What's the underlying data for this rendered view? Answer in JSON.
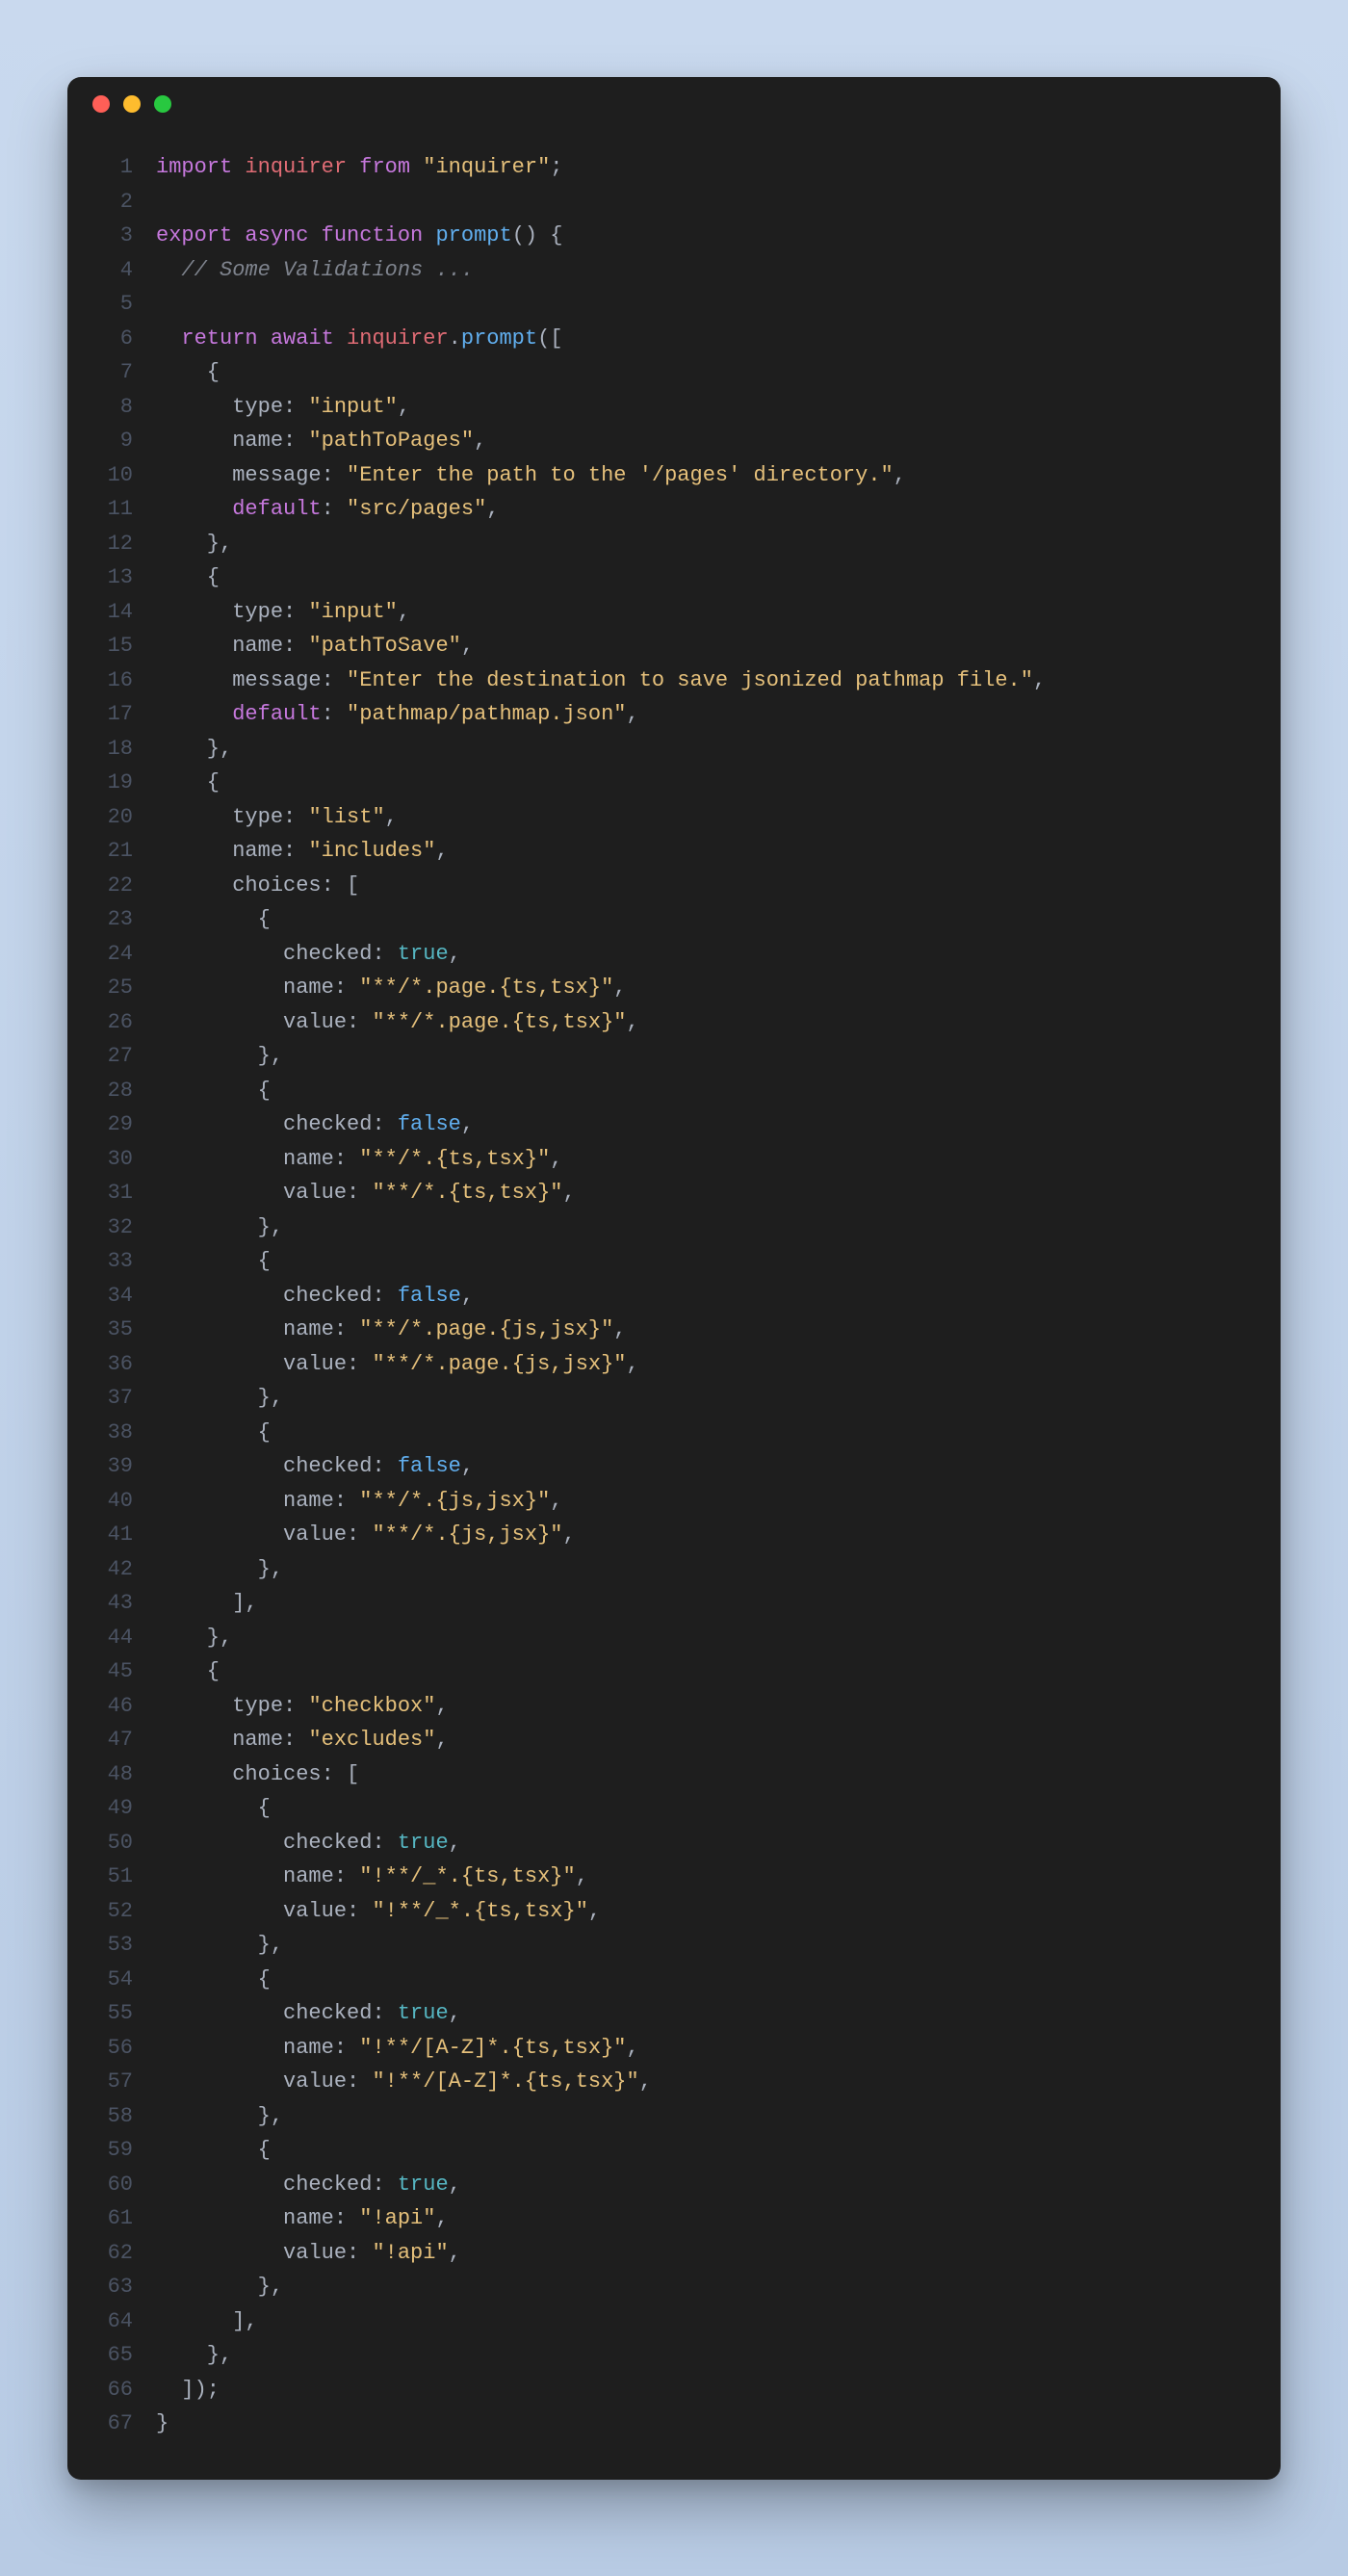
{
  "window": {
    "dots": [
      "red",
      "yellow",
      "green"
    ]
  },
  "lines": [
    {
      "n": 1,
      "tokens": [
        [
          "tk-key",
          "import "
        ],
        [
          "tk-var",
          "inquirer "
        ],
        [
          "tk-key",
          "from "
        ],
        [
          "tk-str2",
          "\"inquirer\""
        ],
        [
          "tk-punc",
          ";"
        ]
      ]
    },
    {
      "n": 2,
      "tokens": []
    },
    {
      "n": 3,
      "tokens": [
        [
          "tk-key",
          "export "
        ],
        [
          "tk-key",
          "async "
        ],
        [
          "tk-key",
          "function "
        ],
        [
          "tk-func",
          "prompt"
        ],
        [
          "tk-punc",
          "() {"
        ]
      ]
    },
    {
      "n": 4,
      "tokens": [
        [
          "tk-punc",
          "  "
        ],
        [
          "tk-comm",
          "// Some Validations ..."
        ]
      ]
    },
    {
      "n": 5,
      "tokens": []
    },
    {
      "n": 6,
      "tokens": [
        [
          "tk-punc",
          "  "
        ],
        [
          "tk-key",
          "return "
        ],
        [
          "tk-key",
          "await "
        ],
        [
          "tk-var",
          "inquirer"
        ],
        [
          "tk-punc",
          "."
        ],
        [
          "tk-func",
          "prompt"
        ],
        [
          "tk-punc",
          "(["
        ]
      ]
    },
    {
      "n": 7,
      "tokens": [
        [
          "tk-punc",
          "    {"
        ]
      ]
    },
    {
      "n": 8,
      "tokens": [
        [
          "tk-punc",
          "      "
        ],
        [
          "tk-prop",
          "type"
        ],
        [
          "tk-punc",
          ": "
        ],
        [
          "tk-str2",
          "\"input\""
        ],
        [
          "tk-punc",
          ","
        ]
      ]
    },
    {
      "n": 9,
      "tokens": [
        [
          "tk-punc",
          "      "
        ],
        [
          "tk-prop",
          "name"
        ],
        [
          "tk-punc",
          ": "
        ],
        [
          "tk-str2",
          "\"pathToPages\""
        ],
        [
          "tk-punc",
          ","
        ]
      ]
    },
    {
      "n": 10,
      "tokens": [
        [
          "tk-punc",
          "      "
        ],
        [
          "tk-prop",
          "message"
        ],
        [
          "tk-punc",
          ": "
        ],
        [
          "tk-str2",
          "\"Enter the path to the '/pages' directory.\""
        ],
        [
          "tk-punc",
          ","
        ]
      ]
    },
    {
      "n": 11,
      "tokens": [
        [
          "tk-punc",
          "      "
        ],
        [
          "tk-key",
          "default"
        ],
        [
          "tk-punc",
          ": "
        ],
        [
          "tk-str2",
          "\"src/pages\""
        ],
        [
          "tk-punc",
          ","
        ]
      ]
    },
    {
      "n": 12,
      "tokens": [
        [
          "tk-punc",
          "    },"
        ]
      ]
    },
    {
      "n": 13,
      "tokens": [
        [
          "tk-punc",
          "    {"
        ]
      ]
    },
    {
      "n": 14,
      "tokens": [
        [
          "tk-punc",
          "      "
        ],
        [
          "tk-prop",
          "type"
        ],
        [
          "tk-punc",
          ": "
        ],
        [
          "tk-str2",
          "\"input\""
        ],
        [
          "tk-punc",
          ","
        ]
      ]
    },
    {
      "n": 15,
      "tokens": [
        [
          "tk-punc",
          "      "
        ],
        [
          "tk-prop",
          "name"
        ],
        [
          "tk-punc",
          ": "
        ],
        [
          "tk-str2",
          "\"pathToSave\""
        ],
        [
          "tk-punc",
          ","
        ]
      ]
    },
    {
      "n": 16,
      "tokens": [
        [
          "tk-punc",
          "      "
        ],
        [
          "tk-prop",
          "message"
        ],
        [
          "tk-punc",
          ": "
        ],
        [
          "tk-str2",
          "\"Enter the destination to save jsonized pathmap file.\""
        ],
        [
          "tk-punc",
          ","
        ]
      ]
    },
    {
      "n": 17,
      "tokens": [
        [
          "tk-punc",
          "      "
        ],
        [
          "tk-key",
          "default"
        ],
        [
          "tk-punc",
          ": "
        ],
        [
          "tk-str2",
          "\"pathmap/pathmap.json\""
        ],
        [
          "tk-punc",
          ","
        ]
      ]
    },
    {
      "n": 18,
      "tokens": [
        [
          "tk-punc",
          "    },"
        ]
      ]
    },
    {
      "n": 19,
      "tokens": [
        [
          "tk-punc",
          "    {"
        ]
      ]
    },
    {
      "n": 20,
      "tokens": [
        [
          "tk-punc",
          "      "
        ],
        [
          "tk-prop",
          "type"
        ],
        [
          "tk-punc",
          ": "
        ],
        [
          "tk-str2",
          "\"list\""
        ],
        [
          "tk-punc",
          ","
        ]
      ]
    },
    {
      "n": 21,
      "tokens": [
        [
          "tk-punc",
          "      "
        ],
        [
          "tk-prop",
          "name"
        ],
        [
          "tk-punc",
          ": "
        ],
        [
          "tk-str2",
          "\"includes\""
        ],
        [
          "tk-punc",
          ","
        ]
      ]
    },
    {
      "n": 22,
      "tokens": [
        [
          "tk-punc",
          "      "
        ],
        [
          "tk-prop",
          "choices"
        ],
        [
          "tk-punc",
          ": ["
        ]
      ]
    },
    {
      "n": 23,
      "tokens": [
        [
          "tk-punc",
          "        {"
        ]
      ]
    },
    {
      "n": 24,
      "tokens": [
        [
          "tk-punc",
          "          "
        ],
        [
          "tk-prop",
          "checked"
        ],
        [
          "tk-punc",
          ": "
        ],
        [
          "tk-bool",
          "true"
        ],
        [
          "tk-punc",
          ","
        ]
      ]
    },
    {
      "n": 25,
      "tokens": [
        [
          "tk-punc",
          "          "
        ],
        [
          "tk-prop",
          "name"
        ],
        [
          "tk-punc",
          ": "
        ],
        [
          "tk-str2",
          "\"**/*.page.{ts,tsx}\""
        ],
        [
          "tk-punc",
          ","
        ]
      ]
    },
    {
      "n": 26,
      "tokens": [
        [
          "tk-punc",
          "          "
        ],
        [
          "tk-prop",
          "value"
        ],
        [
          "tk-punc",
          ": "
        ],
        [
          "tk-str2",
          "\"**/*.page.{ts,tsx}\""
        ],
        [
          "tk-punc",
          ","
        ]
      ]
    },
    {
      "n": 27,
      "tokens": [
        [
          "tk-punc",
          "        },"
        ]
      ]
    },
    {
      "n": 28,
      "tokens": [
        [
          "tk-punc",
          "        {"
        ]
      ]
    },
    {
      "n": 29,
      "tokens": [
        [
          "tk-punc",
          "          "
        ],
        [
          "tk-prop",
          "checked"
        ],
        [
          "tk-punc",
          ": "
        ],
        [
          "tk-boolF",
          "false"
        ],
        [
          "tk-punc",
          ","
        ]
      ]
    },
    {
      "n": 30,
      "tokens": [
        [
          "tk-punc",
          "          "
        ],
        [
          "tk-prop",
          "name"
        ],
        [
          "tk-punc",
          ": "
        ],
        [
          "tk-str2",
          "\"**/*.{ts,tsx}\""
        ],
        [
          "tk-punc",
          ","
        ]
      ]
    },
    {
      "n": 31,
      "tokens": [
        [
          "tk-punc",
          "          "
        ],
        [
          "tk-prop",
          "value"
        ],
        [
          "tk-punc",
          ": "
        ],
        [
          "tk-str2",
          "\"**/*.{ts,tsx}\""
        ],
        [
          "tk-punc",
          ","
        ]
      ]
    },
    {
      "n": 32,
      "tokens": [
        [
          "tk-punc",
          "        },"
        ]
      ]
    },
    {
      "n": 33,
      "tokens": [
        [
          "tk-punc",
          "        {"
        ]
      ]
    },
    {
      "n": 34,
      "tokens": [
        [
          "tk-punc",
          "          "
        ],
        [
          "tk-prop",
          "checked"
        ],
        [
          "tk-punc",
          ": "
        ],
        [
          "tk-boolF",
          "false"
        ],
        [
          "tk-punc",
          ","
        ]
      ]
    },
    {
      "n": 35,
      "tokens": [
        [
          "tk-punc",
          "          "
        ],
        [
          "tk-prop",
          "name"
        ],
        [
          "tk-punc",
          ": "
        ],
        [
          "tk-str2",
          "\"**/*.page.{js,jsx}\""
        ],
        [
          "tk-punc",
          ","
        ]
      ]
    },
    {
      "n": 36,
      "tokens": [
        [
          "tk-punc",
          "          "
        ],
        [
          "tk-prop",
          "value"
        ],
        [
          "tk-punc",
          ": "
        ],
        [
          "tk-str2",
          "\"**/*.page.{js,jsx}\""
        ],
        [
          "tk-punc",
          ","
        ]
      ]
    },
    {
      "n": 37,
      "tokens": [
        [
          "tk-punc",
          "        },"
        ]
      ]
    },
    {
      "n": 38,
      "tokens": [
        [
          "tk-punc",
          "        {"
        ]
      ]
    },
    {
      "n": 39,
      "tokens": [
        [
          "tk-punc",
          "          "
        ],
        [
          "tk-prop",
          "checked"
        ],
        [
          "tk-punc",
          ": "
        ],
        [
          "tk-boolF",
          "false"
        ],
        [
          "tk-punc",
          ","
        ]
      ]
    },
    {
      "n": 40,
      "tokens": [
        [
          "tk-punc",
          "          "
        ],
        [
          "tk-prop",
          "name"
        ],
        [
          "tk-punc",
          ": "
        ],
        [
          "tk-str2",
          "\"**/*.{js,jsx}\""
        ],
        [
          "tk-punc",
          ","
        ]
      ]
    },
    {
      "n": 41,
      "tokens": [
        [
          "tk-punc",
          "          "
        ],
        [
          "tk-prop",
          "value"
        ],
        [
          "tk-punc",
          ": "
        ],
        [
          "tk-str2",
          "\"**/*.{js,jsx}\""
        ],
        [
          "tk-punc",
          ","
        ]
      ]
    },
    {
      "n": 42,
      "tokens": [
        [
          "tk-punc",
          "        },"
        ]
      ]
    },
    {
      "n": 43,
      "tokens": [
        [
          "tk-punc",
          "      ],"
        ]
      ]
    },
    {
      "n": 44,
      "tokens": [
        [
          "tk-punc",
          "    },"
        ]
      ]
    },
    {
      "n": 45,
      "tokens": [
        [
          "tk-punc",
          "    {"
        ]
      ]
    },
    {
      "n": 46,
      "tokens": [
        [
          "tk-punc",
          "      "
        ],
        [
          "tk-prop",
          "type"
        ],
        [
          "tk-punc",
          ": "
        ],
        [
          "tk-str2",
          "\"checkbox\""
        ],
        [
          "tk-punc",
          ","
        ]
      ]
    },
    {
      "n": 47,
      "tokens": [
        [
          "tk-punc",
          "      "
        ],
        [
          "tk-prop",
          "name"
        ],
        [
          "tk-punc",
          ": "
        ],
        [
          "tk-str2",
          "\"excludes\""
        ],
        [
          "tk-punc",
          ","
        ]
      ]
    },
    {
      "n": 48,
      "tokens": [
        [
          "tk-punc",
          "      "
        ],
        [
          "tk-prop",
          "choices"
        ],
        [
          "tk-punc",
          ": ["
        ]
      ]
    },
    {
      "n": 49,
      "tokens": [
        [
          "tk-punc",
          "        {"
        ]
      ]
    },
    {
      "n": 50,
      "tokens": [
        [
          "tk-punc",
          "          "
        ],
        [
          "tk-prop",
          "checked"
        ],
        [
          "tk-punc",
          ": "
        ],
        [
          "tk-bool",
          "true"
        ],
        [
          "tk-punc",
          ","
        ]
      ]
    },
    {
      "n": 51,
      "tokens": [
        [
          "tk-punc",
          "          "
        ],
        [
          "tk-prop",
          "name"
        ],
        [
          "tk-punc",
          ": "
        ],
        [
          "tk-str2",
          "\"!**/_*.{ts,tsx}\""
        ],
        [
          "tk-punc",
          ","
        ]
      ]
    },
    {
      "n": 52,
      "tokens": [
        [
          "tk-punc",
          "          "
        ],
        [
          "tk-prop",
          "value"
        ],
        [
          "tk-punc",
          ": "
        ],
        [
          "tk-str2",
          "\"!**/_*.{ts,tsx}\""
        ],
        [
          "tk-punc",
          ","
        ]
      ]
    },
    {
      "n": 53,
      "tokens": [
        [
          "tk-punc",
          "        },"
        ]
      ]
    },
    {
      "n": 54,
      "tokens": [
        [
          "tk-punc",
          "        {"
        ]
      ]
    },
    {
      "n": 55,
      "tokens": [
        [
          "tk-punc",
          "          "
        ],
        [
          "tk-prop",
          "checked"
        ],
        [
          "tk-punc",
          ": "
        ],
        [
          "tk-bool",
          "true"
        ],
        [
          "tk-punc",
          ","
        ]
      ]
    },
    {
      "n": 56,
      "tokens": [
        [
          "tk-punc",
          "          "
        ],
        [
          "tk-prop",
          "name"
        ],
        [
          "tk-punc",
          ": "
        ],
        [
          "tk-str2",
          "\"!**/[A-Z]*.{ts,tsx}\""
        ],
        [
          "tk-punc",
          ","
        ]
      ]
    },
    {
      "n": 57,
      "tokens": [
        [
          "tk-punc",
          "          "
        ],
        [
          "tk-prop",
          "value"
        ],
        [
          "tk-punc",
          ": "
        ],
        [
          "tk-str2",
          "\"!**/[A-Z]*.{ts,tsx}\""
        ],
        [
          "tk-punc",
          ","
        ]
      ]
    },
    {
      "n": 58,
      "tokens": [
        [
          "tk-punc",
          "        },"
        ]
      ]
    },
    {
      "n": 59,
      "tokens": [
        [
          "tk-punc",
          "        {"
        ]
      ]
    },
    {
      "n": 60,
      "tokens": [
        [
          "tk-punc",
          "          "
        ],
        [
          "tk-prop",
          "checked"
        ],
        [
          "tk-punc",
          ": "
        ],
        [
          "tk-bool",
          "true"
        ],
        [
          "tk-punc",
          ","
        ]
      ]
    },
    {
      "n": 61,
      "tokens": [
        [
          "tk-punc",
          "          "
        ],
        [
          "tk-prop",
          "name"
        ],
        [
          "tk-punc",
          ": "
        ],
        [
          "tk-str2",
          "\"!api\""
        ],
        [
          "tk-punc",
          ","
        ]
      ]
    },
    {
      "n": 62,
      "tokens": [
        [
          "tk-punc",
          "          "
        ],
        [
          "tk-prop",
          "value"
        ],
        [
          "tk-punc",
          ": "
        ],
        [
          "tk-str2",
          "\"!api\""
        ],
        [
          "tk-punc",
          ","
        ]
      ]
    },
    {
      "n": 63,
      "tokens": [
        [
          "tk-punc",
          "        },"
        ]
      ]
    },
    {
      "n": 64,
      "tokens": [
        [
          "tk-punc",
          "      ],"
        ]
      ]
    },
    {
      "n": 65,
      "tokens": [
        [
          "tk-punc",
          "    },"
        ]
      ]
    },
    {
      "n": 66,
      "tokens": [
        [
          "tk-punc",
          "  ]);"
        ]
      ]
    },
    {
      "n": 67,
      "tokens": [
        [
          "tk-punc",
          "}"
        ]
      ]
    }
  ]
}
